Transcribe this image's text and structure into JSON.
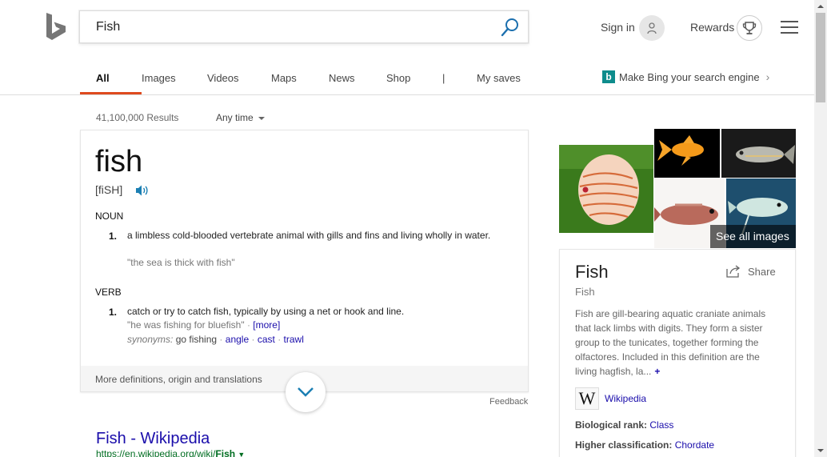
{
  "search": {
    "query": "Fish"
  },
  "header": {
    "sign_in": "Sign in",
    "rewards": "Rewards"
  },
  "nav": {
    "items": [
      {
        "label": "All",
        "active": true
      },
      {
        "label": "Images"
      },
      {
        "label": "Videos"
      },
      {
        "label": "Maps"
      },
      {
        "label": "News"
      },
      {
        "label": "Shop"
      },
      {
        "label": "|"
      },
      {
        "label": "My saves"
      }
    ],
    "promo": "Make Bing your search engine"
  },
  "results_meta": {
    "count": "41,100,000 Results",
    "time_filter": "Any time"
  },
  "definition": {
    "word": "fish",
    "pronunciation": "[fiSH]",
    "noun_label": "NOUN",
    "noun_num": "1.",
    "noun_text": "a limbless cold-blooded vertebrate animal with gills and fins and living wholly in water.",
    "noun_example": "\"the sea is thick with fish\"",
    "verb_label": "VERB",
    "verb_num": "1.",
    "verb_text": "catch or try to catch fish, typically by using a net or hook and line.",
    "verb_example": "\"he was fishing for bluefish\"",
    "more": "[more]",
    "synonyms_label": "synonyms:",
    "synonyms": [
      "go fishing",
      "angle",
      "cast",
      "trawl"
    ],
    "footer": "More definitions, origin and translations"
  },
  "feedback": "Feedback",
  "result": {
    "title": "Fish - Wikipedia",
    "url_prefix": "https://en.wikipedia.org/wiki/",
    "url_bold": "Fish"
  },
  "images": {
    "see_all": "See all images"
  },
  "entity": {
    "title": "Fish",
    "subtitle": "Fish",
    "share": "Share",
    "description": "Fish are gill-bearing aquatic craniate animals that lack limbs with digits. They form a sister group to the tunicates, together forming the olfactores. Included in this definition are the living hagfish, la...",
    "plus": "+",
    "wiki_logo": "W",
    "wiki_label": "Wikipedia",
    "facts": [
      {
        "label": "Biological rank:",
        "value": "Class"
      },
      {
        "label": "Higher classification:",
        "value": "Chordate"
      }
    ]
  },
  "colors": {
    "accent": "#de4a1f",
    "link": "#1a0dab",
    "url": "#006d21",
    "brand": "#0e8c8c"
  }
}
